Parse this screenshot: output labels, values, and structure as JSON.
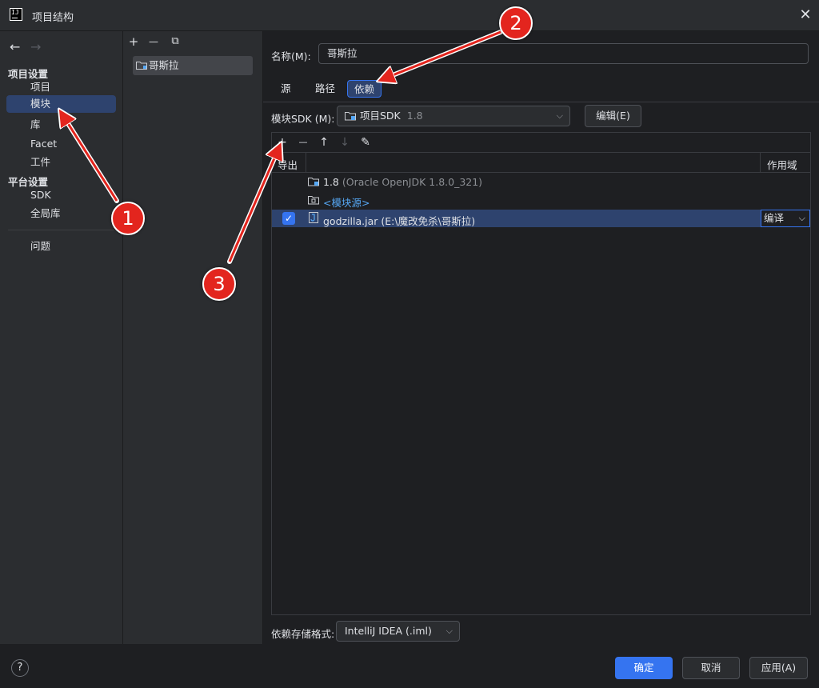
{
  "window": {
    "title": "项目结构",
    "close_glyph": "✕"
  },
  "sidebar": {
    "back_glyph": "←",
    "forward_glyph": "→",
    "project_settings_header": "项目设置",
    "project_items": [
      "项目",
      "模块",
      "库",
      "Facet",
      "工件"
    ],
    "platform_settings_header": "平台设置",
    "platform_items": [
      "SDK",
      "全局库"
    ],
    "problems_item": "问题",
    "selected": "模块"
  },
  "module_list": {
    "add_glyph": "+",
    "remove_glyph": "—",
    "copy_glyph": "⧉",
    "items": [
      "哥斯拉"
    ]
  },
  "main": {
    "name_label": "名称(M):",
    "name_value": "哥斯拉",
    "tabs": [
      "源",
      "路径",
      "依赖"
    ],
    "active_tab": "依赖",
    "sdk_label": "模块SDK (M):",
    "sdk_value": "项目SDK",
    "sdk_version": "1.8",
    "edit_button": "编辑(E)",
    "deps_toolbar": {
      "add": "+",
      "remove": "—",
      "up": "↑",
      "down": "↓",
      "edit": "✎"
    },
    "col_export": "导出",
    "col_scope": "作用域",
    "rows": {
      "jdk_name": "1.8",
      "jdk_detail": "(Oracle OpenJDK 1.8.0_321)",
      "module_source": "<模块源>",
      "jar_name": "godzilla.jar",
      "jar_path": "(E:\\魔改免杀\\哥斯拉)",
      "jar_scope": "编译",
      "jar_exported": true
    },
    "storage_label": "依赖存储格式:",
    "storage_value": "IntelliJ IDEA (.iml)"
  },
  "footer": {
    "help": "?",
    "ok": "确定",
    "cancel": "取消",
    "apply": "应用(A)"
  },
  "annotations": {
    "badge1": "1",
    "badge2": "2",
    "badge3": "3",
    "color": "#e3251e"
  },
  "colors": {
    "accent": "#3574f0",
    "selection": "#2e436e",
    "link": "#56a8f5"
  }
}
